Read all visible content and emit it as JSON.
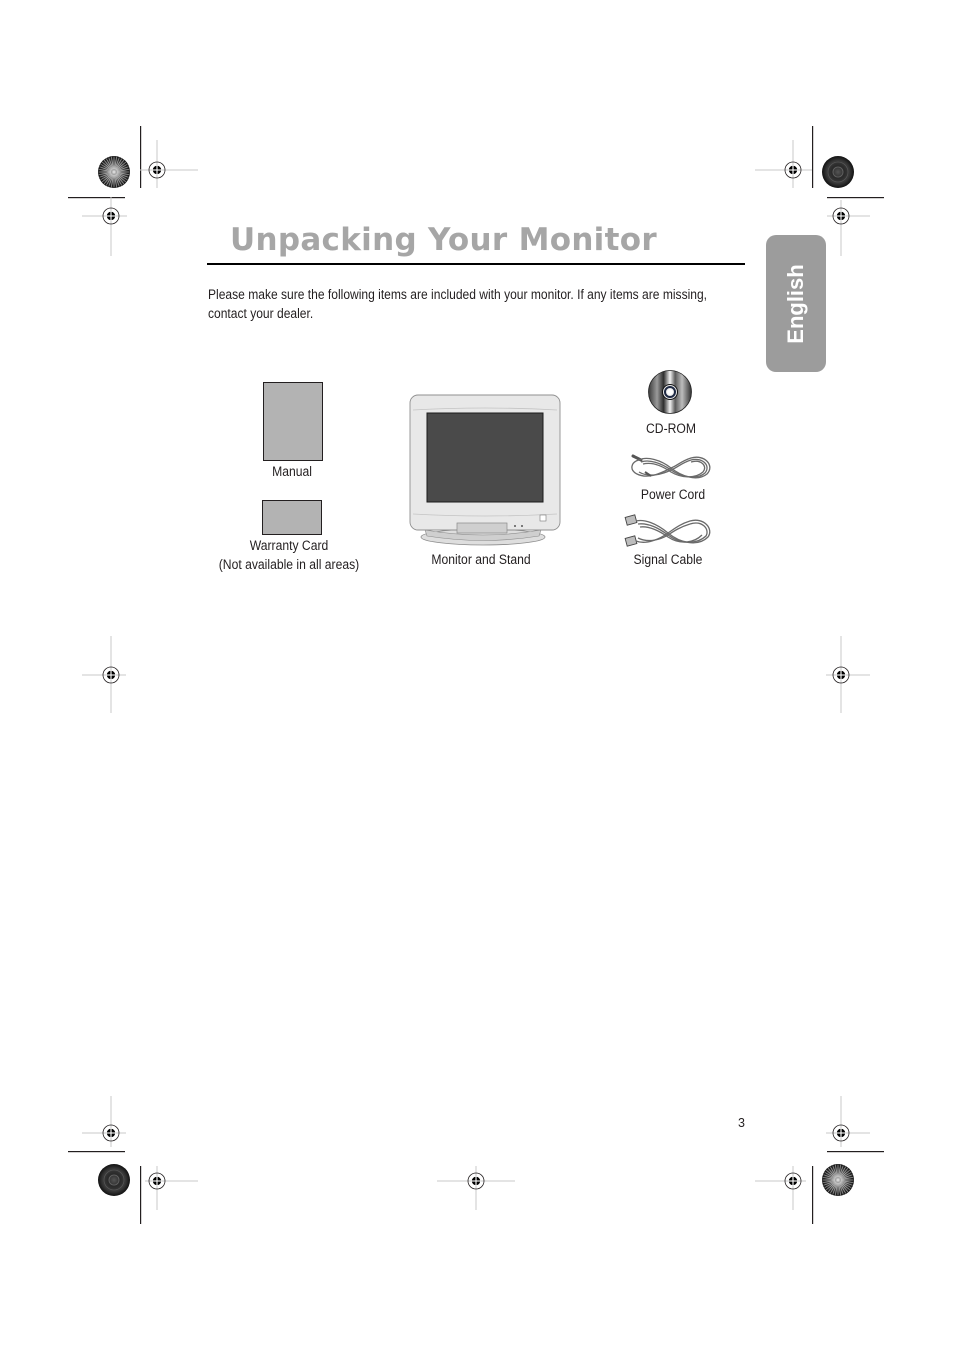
{
  "page": {
    "title": "Unpacking Your Monitor",
    "language_tab": "English",
    "intro_text": "Please make sure the following items are included with your monitor. If any items are missing, contact your dealer.",
    "page_number": "3"
  },
  "items": {
    "manual": "Manual",
    "warranty_card_line1": "Warranty Card",
    "warranty_card_line2": "(Not available in all areas)",
    "monitor": "Monitor and Stand",
    "cdrom": "CD-ROM",
    "power_cord": "Power Cord",
    "signal_cable": "Signal Cable"
  },
  "icons": {
    "registration_mark": "crosshair-target-icon",
    "color_wheel": "starburst-registration-icon",
    "cd": "cd-rom-icon",
    "cable": "coiled-cable-icon",
    "monitor": "crt-monitor-icon"
  },
  "colors": {
    "title_gray": "#a6a6a6",
    "tab_gray": "#9c9c9c",
    "box_gray": "#b3b3b3",
    "screen": "#4a4a4a",
    "bezel": "#e6e6e6"
  }
}
